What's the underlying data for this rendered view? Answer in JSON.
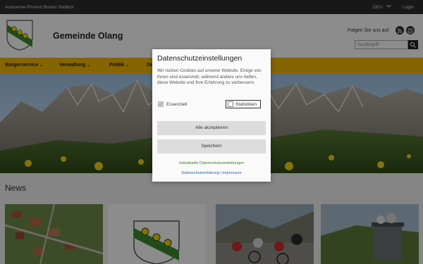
{
  "topbar": {
    "region": "Autonome Provinz Bozen Südtirol",
    "language": "DEU",
    "login": "Login"
  },
  "header": {
    "title": "Gemeinde Olang",
    "follow_label": "Folgen Sie uns auf",
    "search_placeholder": "Suchbegriff"
  },
  "nav": {
    "items": [
      "Bürgerservice",
      "Verwaltung",
      "Politik",
      "De"
    ]
  },
  "news": {
    "heading": "News"
  },
  "cookie_dialog": {
    "title": "Datenschutzeinstellungen",
    "text": "Wir nutzen Cookies auf unserer Website. Einige von ihnen sind essenziell, während andere uns helfen, diese Website und Ihre Erfahrung zu verbessern.",
    "options": [
      {
        "label": "Essenziell",
        "checked": true,
        "disabled": true
      },
      {
        "label": "Statistiken",
        "checked": false,
        "disabled": false
      }
    ],
    "accept_all": "Alle akzeptieren",
    "save": "Speichern",
    "individual_link": "Individuelle Datenschutzeinstellungen",
    "privacy_link": "Datenschutzerklärung",
    "separator": "|",
    "imprint_link": "Impressum"
  },
  "colors": {
    "nav_bg": "#f2b705",
    "topbar_bg": "#2d2d2d",
    "link_green": "#3a7a22",
    "link_blue": "#2a5fa8"
  }
}
